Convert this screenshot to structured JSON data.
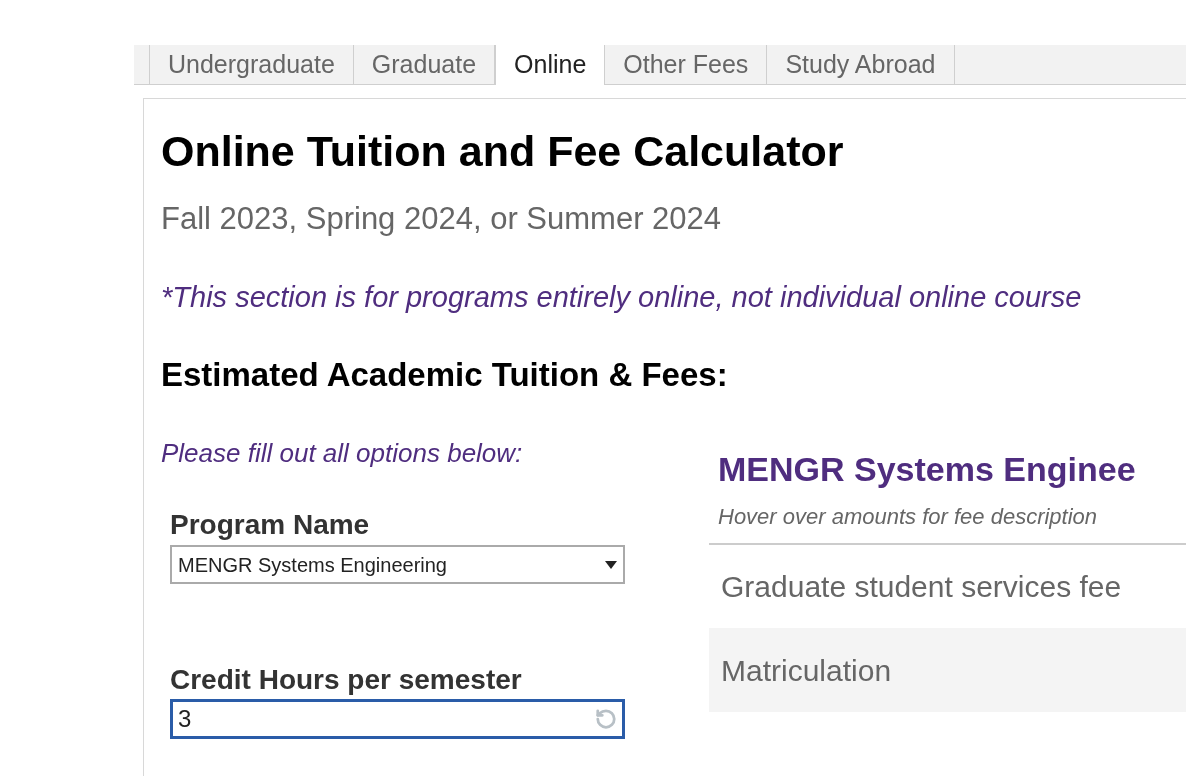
{
  "tabs": [
    {
      "label": "Undergraduate",
      "selected": false
    },
    {
      "label": "Graduate",
      "selected": false
    },
    {
      "label": "Online",
      "selected": true
    },
    {
      "label": "Other Fees",
      "selected": false
    },
    {
      "label": "Study Abroad",
      "selected": false
    }
  ],
  "title": "Online Tuition and Fee Calculator",
  "subtitle": "Fall 2023, Spring 2024, or Summer 2024",
  "note": "*This section is for programs entirely online, not individual online course",
  "section_heading": "Estimated Academic Tuition & Fees:",
  "form": {
    "instruction": "Please fill out all options below:",
    "program": {
      "label": "Program Name",
      "value": "MENGR Systems Engineering"
    },
    "credit_hours": {
      "label": "Credit Hours per semester",
      "value": "3",
      "focused": true
    }
  },
  "summary": {
    "heading": "MENGR Systems Enginee",
    "hint": "Hover over amounts for fee description",
    "rows": [
      {
        "label": "Graduate student services fee"
      },
      {
        "label": "Matriculation"
      }
    ]
  }
}
